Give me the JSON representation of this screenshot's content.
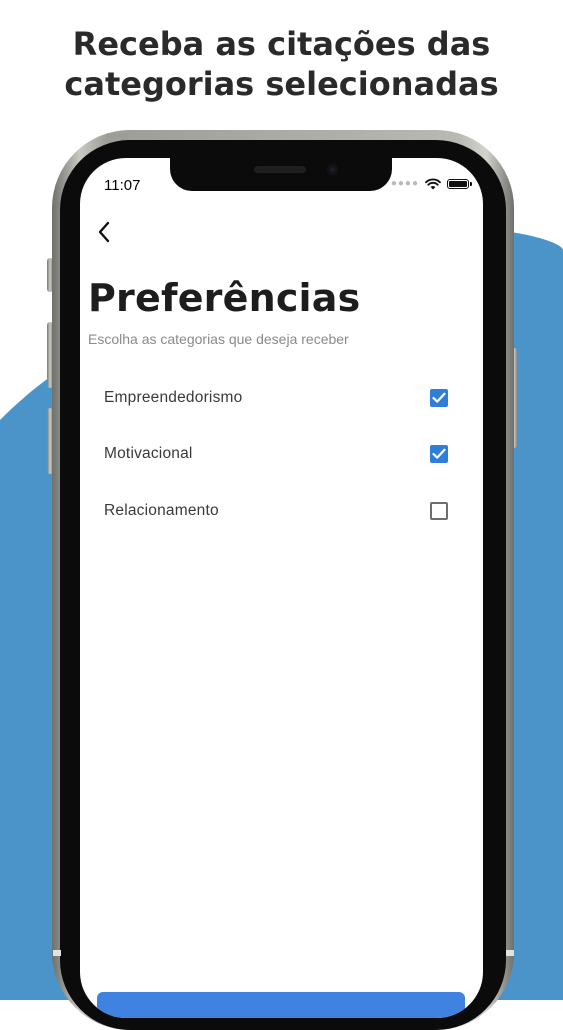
{
  "headline": {
    "line1": "Receba as citações das",
    "line2": "categorias selecionadas"
  },
  "status_bar": {
    "time": "11:07",
    "signal_icon": "signal-dots-icon",
    "wifi_icon": "wifi-icon",
    "battery_icon": "battery-icon"
  },
  "nav": {
    "back_icon": "chevron-left-icon"
  },
  "page": {
    "title": "Preferências",
    "subtitle": "Escolha as categorias que deseja receber"
  },
  "categories": [
    {
      "label": "Empreendedorismo",
      "checked": true
    },
    {
      "label": "Motivacional",
      "checked": true
    },
    {
      "label": "Relacionamento",
      "checked": false
    }
  ],
  "colors": {
    "accent": "#2f7fd8",
    "background_wave": "#4a94c9",
    "headline_text": "#2a2a2a"
  }
}
